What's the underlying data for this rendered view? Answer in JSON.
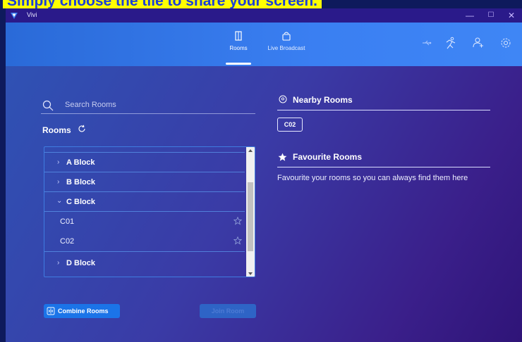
{
  "banner": {
    "text": "Simply choose the tile to share your screen."
  },
  "app": {
    "title": "Vivi",
    "brand_color": "#3a7ff2"
  },
  "window_controls": {
    "minimize": "—",
    "maximize": "☐",
    "close": "✕"
  },
  "nav": {
    "tabs": [
      {
        "label": "Rooms",
        "icon": "door-icon",
        "active": true
      },
      {
        "label": "Live Broadcast",
        "icon": "broadcast-icon",
        "active": false
      }
    ],
    "right_icons": [
      "usb-icon",
      "runner-icon",
      "add-user-icon",
      "settings-icon"
    ]
  },
  "search": {
    "placeholder": "Search Rooms",
    "value": ""
  },
  "rooms": {
    "heading": "Rooms",
    "items": [
      {
        "label": "A Block",
        "type": "group",
        "expanded": false
      },
      {
        "label": "B Block",
        "type": "group",
        "expanded": false
      },
      {
        "label": "C Block",
        "type": "group",
        "expanded": true
      },
      {
        "label": "C01",
        "type": "room",
        "favourite": false
      },
      {
        "label": "C02",
        "type": "room",
        "favourite": false
      },
      {
        "label": "D Block",
        "type": "group",
        "expanded": false
      }
    ]
  },
  "buttons": {
    "combine": "Combine Rooms",
    "join": "Join Room"
  },
  "nearby": {
    "title": "Nearby Rooms",
    "rooms": [
      "C02"
    ]
  },
  "favourites": {
    "title": "Favourite Rooms",
    "description": "Favourite your rooms so you can always find them here"
  }
}
